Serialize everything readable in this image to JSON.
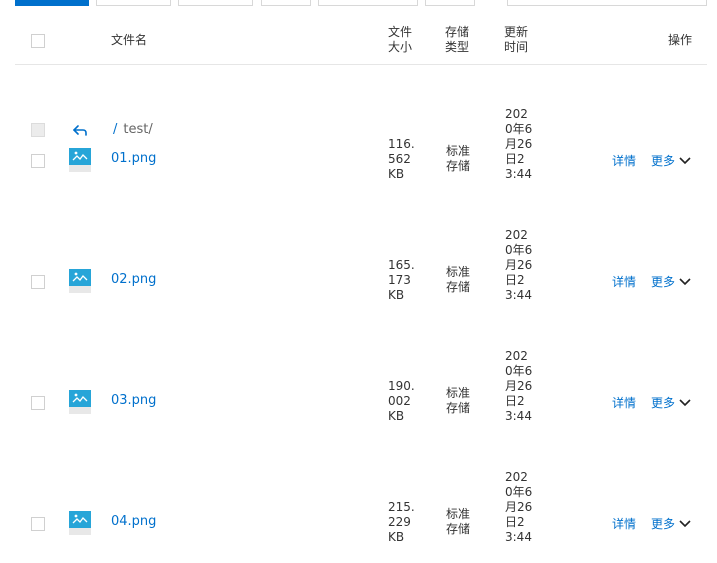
{
  "header": {
    "filename": "文件名",
    "size": "文件大小",
    "storage_class": "存储类型",
    "updated": "更新时间",
    "actions": "操作"
  },
  "breadcrumb": {
    "root": "/",
    "path": "test/"
  },
  "rows": [
    {
      "name": "01.png",
      "size": "116.562KB",
      "storage_class": "标准存储",
      "updated": "2020年6月26日23:44",
      "details": "详情",
      "more": "更多"
    },
    {
      "name": "02.png",
      "size": "165.173KB",
      "storage_class": "标准存储",
      "updated": "2020年6月26日23:44",
      "details": "详情",
      "more": "更多"
    },
    {
      "name": "03.png",
      "size": "190.002KB",
      "storage_class": "标准存储",
      "updated": "2020年6月26日23:44",
      "details": "详情",
      "more": "更多"
    },
    {
      "name": "04.png",
      "size": "215.229KB",
      "storage_class": "标准存储",
      "updated": "2020年6月26日23:44",
      "details": "详情",
      "more": "更多"
    }
  ],
  "icons": {
    "file": "image-file-icon",
    "back": "back-arrow-icon",
    "more": "chevron-down-icon",
    "accent": "#0070cc",
    "image_thumb": "#27a5d8"
  }
}
